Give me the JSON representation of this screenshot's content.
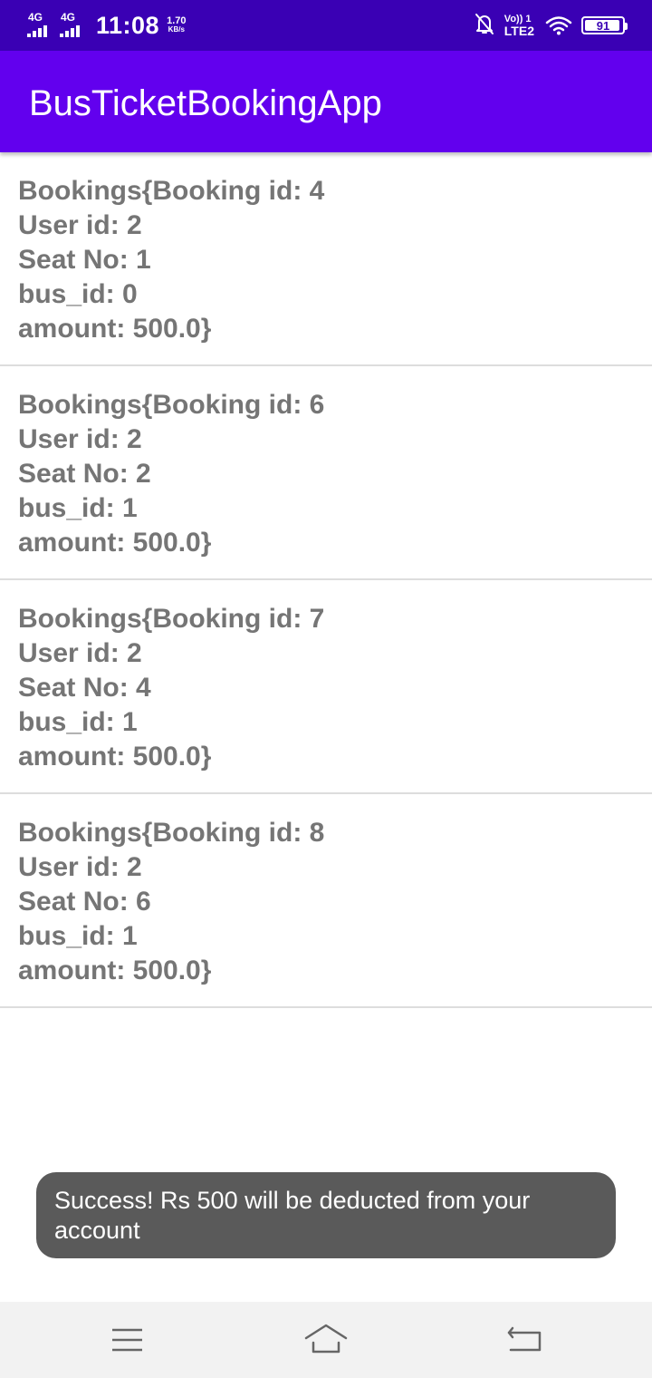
{
  "status_bar": {
    "network_1": "4G",
    "network_2": "4G",
    "time": "11:08",
    "speed_value": "1.70",
    "speed_unit": "KB/s",
    "volte_top": "Vo)) 1",
    "volte_bottom": "LTE2",
    "battery_level": "91",
    "icons": [
      "signal-icon",
      "signal-icon",
      "mute-icon",
      "wifi-icon",
      "battery-icon"
    ]
  },
  "app_bar": {
    "title": "BusTicketBookingApp"
  },
  "bookings": [
    {
      "line1": "Bookings{Booking id: 4",
      "line2": "User id: 2",
      "line3": "Seat No: 1",
      "line4": "bus_id: 0",
      "line5": "amount: 500.0}"
    },
    {
      "line1": "Bookings{Booking id: 6",
      "line2": "User id: 2",
      "line3": "Seat No: 2",
      "line4": "bus_id: 1",
      "line5": "amount: 500.0}"
    },
    {
      "line1": "Bookings{Booking id: 7",
      "line2": "User id: 2",
      "line3": "Seat No: 4",
      "line4": "bus_id: 1",
      "line5": "amount: 500.0}"
    },
    {
      "line1": "Bookings{Booking id: 8",
      "line2": "User id: 2",
      "line3": "Seat No: 6",
      "line4": "bus_id: 1",
      "line5": "amount: 500.0}"
    }
  ],
  "toast": {
    "message": "Success! Rs 500 will be deducted from your account"
  },
  "nav_bar": {
    "icons": [
      "menu-icon",
      "home-icon",
      "back-icon"
    ]
  },
  "colors": {
    "status_bar": "#3a00b4",
    "app_bar": "#6200ee",
    "item_text": "#757575",
    "toast_bg": "#5a5a5a",
    "nav_bg": "#f2f2f2"
  }
}
